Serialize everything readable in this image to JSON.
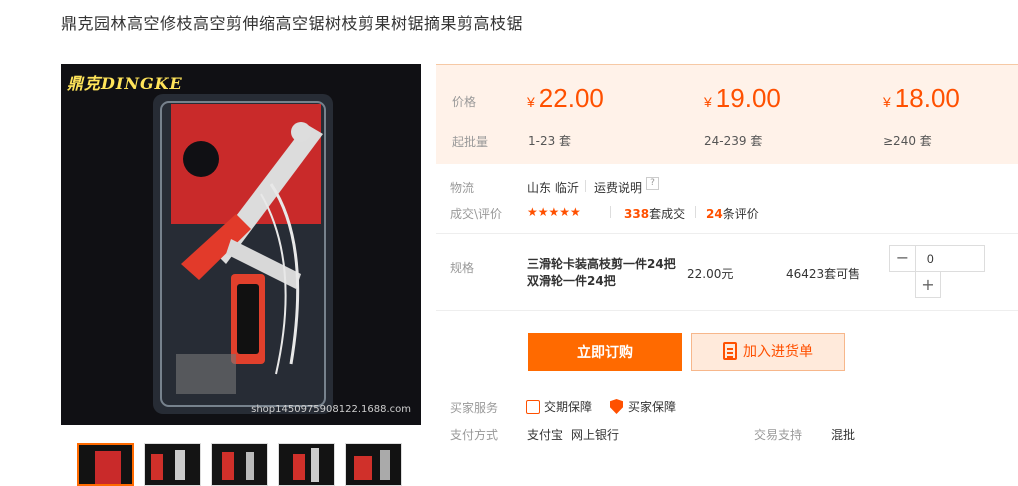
{
  "product": {
    "title": "鼎克园林高空修枝高空剪伸缩高空锯树枝剪果树锯摘果剪高枝锯",
    "image_brand": "鼎克DINGKE",
    "image_watermark": "shop1450975908122.1688.com"
  },
  "price_panel": {
    "price_label": "价格",
    "moq_label": "起批量",
    "currency": "¥",
    "tiers": [
      {
        "price": "22.00",
        "qty": "1-23 套"
      },
      {
        "price": "19.00",
        "qty": "24-239 套"
      },
      {
        "price": "18.00",
        "qty": "≥240 套"
      }
    ]
  },
  "logistics": {
    "label": "物流",
    "location": "山东 临沂",
    "shipping_link": "运费说明",
    "help_icon": "?"
  },
  "deals": {
    "label": "成交\\评价",
    "rating": 4.5,
    "stars": "★★★★★",
    "sold_count": "338",
    "sold_suffix": "套成交",
    "review_count": "24",
    "review_suffix": "条评价"
  },
  "spec": {
    "label": "规格",
    "line1": "三滑轮卡装高枝剪一件24把",
    "line2": "双滑轮一件24把",
    "price": "22.00元",
    "stock": "46423套可售",
    "quantity": "0",
    "minus": "−",
    "plus": "+"
  },
  "actions": {
    "buy_now": "立即订购",
    "add_cart": "加入进货单"
  },
  "services": {
    "label": "买家服务",
    "items": [
      "交期保障",
      "买家保障"
    ]
  },
  "payment": {
    "label": "支付方式",
    "methods": [
      "支付宝",
      "网上银行"
    ],
    "support_label": "交易支持",
    "support_value": "混批"
  },
  "colors": {
    "accent": "#ff5000",
    "button": "#ff6a00",
    "panel_bg": "#fff2e9"
  }
}
